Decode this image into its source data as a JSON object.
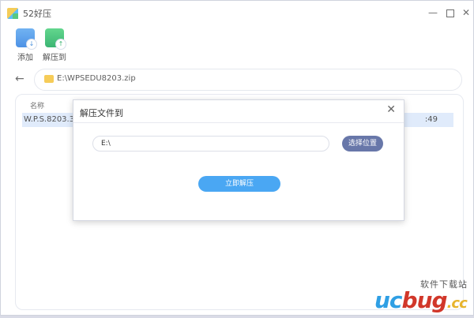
{
  "window": {
    "title": "52好压"
  },
  "toolbar": {
    "add_label": "添加",
    "extract_label": "解压到"
  },
  "pathbar": {
    "path": "E:\\WPSEDU8203.zip"
  },
  "file_list": {
    "column_name": "名称",
    "rows": [
      {
        "name": "W.P.S.8203.30.",
        "time_fragment": ":49"
      }
    ]
  },
  "dialog": {
    "title": "解压文件到",
    "destination_value": "E:\\",
    "choose_label": "选择位置",
    "extract_now_label": "立即解压"
  },
  "watermark": {
    "top_text": "软件下载站",
    "brand_uc": "uc",
    "brand_bug": "bug",
    "brand_cc": ".cc"
  },
  "colors": {
    "accent_blue": "#4aa7f3",
    "choose_button": "#6877a9",
    "selection_row": "#dbe8fb"
  },
  "icons": {
    "add": "archive-add-icon",
    "extract": "archive-extract-icon",
    "folder": "folder-icon",
    "back": "back-arrow-icon"
  }
}
